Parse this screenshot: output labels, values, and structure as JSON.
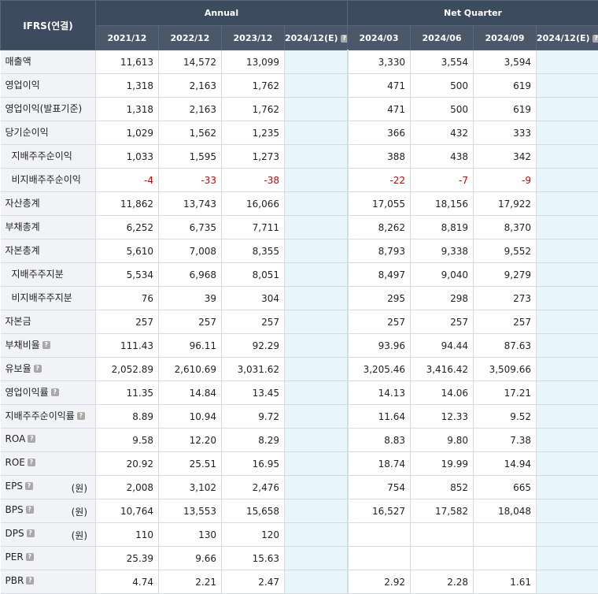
{
  "header": {
    "corner": "IFRS(연결)",
    "annual_label": "Annual",
    "quarter_label": "Net Quarter",
    "help_glyph": "?",
    "annual_periods": [
      "2021/12",
      "2022/12",
      "2023/12",
      "2024/12(E)"
    ],
    "quarter_periods": [
      "2024/03",
      "2024/06",
      "2024/09",
      "2024/12(E)"
    ]
  },
  "colors": {
    "header_bg": "#3d4b5e",
    "label_bg": "#f1f3f6",
    "estimate_bg": "#e8f5fb",
    "negative": "#cc0000"
  },
  "rows": [
    {
      "label": "매출액",
      "sub": false,
      "help": false,
      "unit": "",
      "annual": [
        "11,613",
        "14,572",
        "13,099",
        ""
      ],
      "quarter": [
        "3,330",
        "3,554",
        "3,594",
        ""
      ]
    },
    {
      "label": "영업이익",
      "sub": false,
      "help": false,
      "unit": "",
      "annual": [
        "1,318",
        "2,163",
        "1,762",
        ""
      ],
      "quarter": [
        "471",
        "500",
        "619",
        ""
      ]
    },
    {
      "label": "영업이익(발표기준)",
      "sub": false,
      "help": false,
      "unit": "",
      "annual": [
        "1,318",
        "2,163",
        "1,762",
        ""
      ],
      "quarter": [
        "471",
        "500",
        "619",
        ""
      ]
    },
    {
      "label": "당기순이익",
      "sub": false,
      "help": false,
      "unit": "",
      "annual": [
        "1,029",
        "1,562",
        "1,235",
        ""
      ],
      "quarter": [
        "366",
        "432",
        "333",
        ""
      ]
    },
    {
      "label": "지배주주순이익",
      "sub": true,
      "help": false,
      "unit": "",
      "annual": [
        "1,033",
        "1,595",
        "1,273",
        ""
      ],
      "quarter": [
        "388",
        "438",
        "342",
        ""
      ]
    },
    {
      "label": "비지배주주순이익",
      "sub": true,
      "help": false,
      "unit": "",
      "annual": [
        "-4",
        "-33",
        "-38",
        ""
      ],
      "quarter": [
        "-22",
        "-7",
        "-9",
        ""
      ]
    },
    {
      "label": "자산총계",
      "sub": false,
      "help": false,
      "unit": "",
      "annual": [
        "11,862",
        "13,743",
        "16,066",
        ""
      ],
      "quarter": [
        "17,055",
        "18,156",
        "17,922",
        ""
      ]
    },
    {
      "label": "부채총계",
      "sub": false,
      "help": false,
      "unit": "",
      "annual": [
        "6,252",
        "6,735",
        "7,711",
        ""
      ],
      "quarter": [
        "8,262",
        "8,819",
        "8,370",
        ""
      ]
    },
    {
      "label": "자본총계",
      "sub": false,
      "help": false,
      "unit": "",
      "annual": [
        "5,610",
        "7,008",
        "8,355",
        ""
      ],
      "quarter": [
        "8,793",
        "9,338",
        "9,552",
        ""
      ]
    },
    {
      "label": "지배주주지분",
      "sub": true,
      "help": false,
      "unit": "",
      "annual": [
        "5,534",
        "6,968",
        "8,051",
        ""
      ],
      "quarter": [
        "8,497",
        "9,040",
        "9,279",
        ""
      ]
    },
    {
      "label": "비지배주주지분",
      "sub": true,
      "help": false,
      "unit": "",
      "annual": [
        "76",
        "39",
        "304",
        ""
      ],
      "quarter": [
        "295",
        "298",
        "273",
        ""
      ]
    },
    {
      "label": "자본금",
      "sub": false,
      "help": false,
      "unit": "",
      "annual": [
        "257",
        "257",
        "257",
        ""
      ],
      "quarter": [
        "257",
        "257",
        "257",
        ""
      ]
    },
    {
      "label": "부채비율",
      "sub": false,
      "help": true,
      "unit": "",
      "annual": [
        "111.43",
        "96.11",
        "92.29",
        ""
      ],
      "quarter": [
        "93.96",
        "94.44",
        "87.63",
        ""
      ]
    },
    {
      "label": "유보율",
      "sub": false,
      "help": true,
      "unit": "",
      "annual": [
        "2,052.89",
        "2,610.69",
        "3,031.62",
        ""
      ],
      "quarter": [
        "3,205.46",
        "3,416.42",
        "3,509.66",
        ""
      ]
    },
    {
      "label": "영업이익률",
      "sub": false,
      "help": true,
      "unit": "",
      "annual": [
        "11.35",
        "14.84",
        "13.45",
        ""
      ],
      "quarter": [
        "14.13",
        "14.06",
        "17.21",
        ""
      ]
    },
    {
      "label": "지배주주순이익률",
      "sub": false,
      "help": true,
      "unit": "",
      "annual": [
        "8.89",
        "10.94",
        "9.72",
        ""
      ],
      "quarter": [
        "11.64",
        "12.33",
        "9.52",
        ""
      ]
    },
    {
      "label": "ROA",
      "sub": false,
      "help": true,
      "unit": "",
      "annual": [
        "9.58",
        "12.20",
        "8.29",
        ""
      ],
      "quarter": [
        "8.83",
        "9.80",
        "7.38",
        ""
      ]
    },
    {
      "label": "ROE",
      "sub": false,
      "help": true,
      "unit": "",
      "annual": [
        "20.92",
        "25.51",
        "16.95",
        ""
      ],
      "quarter": [
        "18.74",
        "19.99",
        "14.94",
        ""
      ]
    },
    {
      "label": "EPS",
      "sub": false,
      "help": true,
      "unit": "(원)",
      "annual": [
        "2,008",
        "3,102",
        "2,476",
        ""
      ],
      "quarter": [
        "754",
        "852",
        "665",
        ""
      ]
    },
    {
      "label": "BPS",
      "sub": false,
      "help": true,
      "unit": "(원)",
      "annual": [
        "10,764",
        "13,553",
        "15,658",
        ""
      ],
      "quarter": [
        "16,527",
        "17,582",
        "18,048",
        ""
      ]
    },
    {
      "label": "DPS",
      "sub": false,
      "help": true,
      "unit": "(원)",
      "annual": [
        "110",
        "130",
        "120",
        ""
      ],
      "quarter": [
        "",
        "",
        "",
        ""
      ]
    },
    {
      "label": "PER",
      "sub": false,
      "help": true,
      "unit": "",
      "annual": [
        "25.39",
        "9.66",
        "15.63",
        ""
      ],
      "quarter": [
        "",
        "",
        "",
        ""
      ]
    },
    {
      "label": "PBR",
      "sub": false,
      "help": true,
      "unit": "",
      "annual": [
        "4.74",
        "2.21",
        "2.47",
        ""
      ],
      "quarter": [
        "2.92",
        "2.28",
        "1.61",
        ""
      ]
    }
  ]
}
